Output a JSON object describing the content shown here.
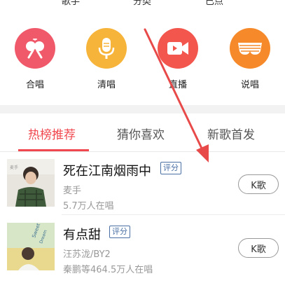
{
  "top_labels": [
    "歌手",
    "分类",
    "已点"
  ],
  "categories": [
    {
      "label": "合唱",
      "icon": "duet-icon",
      "color": "#f0596a"
    },
    {
      "label": "清唱",
      "icon": "microphone-icon",
      "color": "#f7b43a"
    },
    {
      "label": "直播",
      "icon": "video-camera-icon",
      "color": "#f2564d"
    },
    {
      "label": "说唱",
      "icon": "shutter-glasses-icon",
      "color": "#f68a2a"
    }
  ],
  "tabs": [
    {
      "label": "热榜推荐",
      "active": true
    },
    {
      "label": "猜你喜欢",
      "active": false
    },
    {
      "label": "新歌首发",
      "active": false
    }
  ],
  "songs": [
    {
      "title": "死在江南烟雨中",
      "badge": "评分",
      "artist": "麦手",
      "plays": "5.7万人在唱",
      "button": "K歌"
    },
    {
      "title": "有点甜",
      "badge": "评分",
      "artist": "汪苏泷/BY2",
      "plays": "秦鹏等464.5万人在唱",
      "button": "K歌"
    }
  ],
  "colors": {
    "accent": "#f0484e",
    "badge": "#4a6fa5",
    "annotation_arrow": "#e84a4a"
  }
}
